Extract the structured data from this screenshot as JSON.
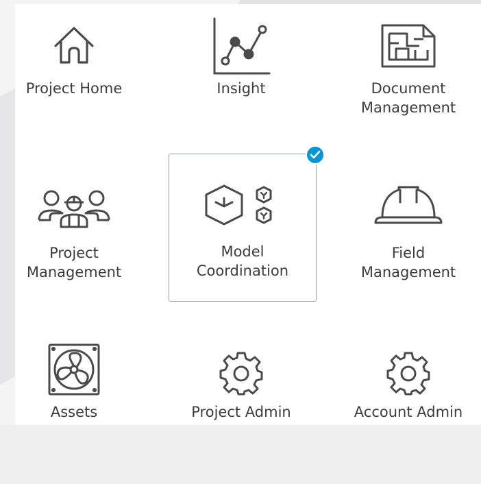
{
  "apps": {
    "items": [
      {
        "label": "Project Home",
        "icon": "home-icon",
        "selected": false
      },
      {
        "label": "Insight",
        "icon": "insight-chart-icon",
        "selected": false
      },
      {
        "label": "Document\nManagement",
        "icon": "document-management-icon",
        "selected": false
      },
      {
        "label": "Project\nManagement",
        "icon": "project-management-icon",
        "selected": false
      },
      {
        "label": "Model\nCoordination",
        "icon": "model-coordination-icon",
        "selected": true
      },
      {
        "label": "Field\nManagement",
        "icon": "hard-hat-icon",
        "selected": false
      },
      {
        "label": "Assets",
        "icon": "assets-fan-icon",
        "selected": false
      },
      {
        "label": "Project Admin",
        "icon": "gear-icon",
        "selected": false
      },
      {
        "label": "Account Admin",
        "icon": "gear-icon",
        "selected": false
      }
    ],
    "selected_badge_icon": "checkmark-icon"
  },
  "colors": {
    "icon": "#4a4a4a",
    "text": "#3c3c3c",
    "accent": "#0696d7",
    "selected_border": "#9aa0a6"
  }
}
